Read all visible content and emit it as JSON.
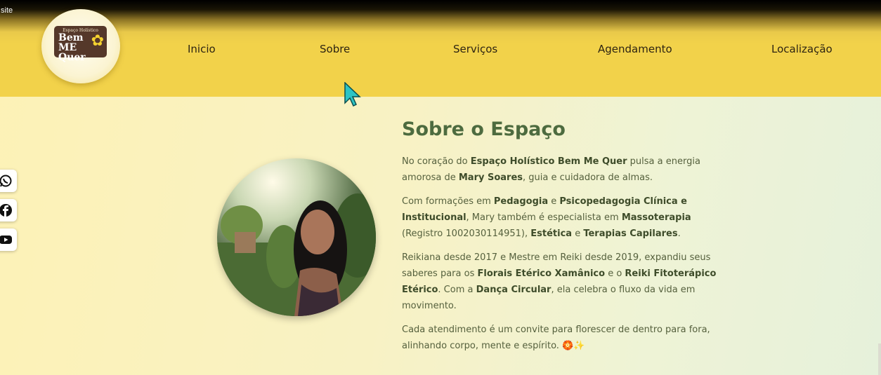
{
  "window": {
    "title_fragment": "site"
  },
  "logo": {
    "small_text": "Espaço Holístico",
    "line1": "Bem",
    "line2": "ME Quer"
  },
  "nav": {
    "items": [
      "Inicio",
      "Sobre",
      "Serviços",
      "Agendamento",
      "Localização"
    ]
  },
  "social": [
    "whatsapp-icon",
    "facebook-icon",
    "youtube-icon"
  ],
  "about": {
    "title": "Sobre o Espaço",
    "p1": {
      "t1": "No coração do ",
      "b1": "Espaço Holístico Bem Me Quer",
      "t2": " pulsa a energia amorosa de ",
      "b2": "Mary Soares",
      "t3": ", guia e cuidadora de almas."
    },
    "p2": {
      "t1": "Com formações em ",
      "b1": "Pedagogia",
      "t2": " e ",
      "b2": "Psicopedagogia Clínica e Institucional",
      "t3": ", Mary também é especialista em ",
      "b3": "Massoterapia",
      "t4": " (Registro 1002030114951), ",
      "b4": "Estética",
      "t5": " e ",
      "b5": "Terapias Capilares",
      "t6": "."
    },
    "p3": {
      "t1": "Reikiana desde 2017 e Mestre em Reiki desde 2019, expandiu seus saberes para os ",
      "b1": "Florais Etérico Xamânico",
      "t2": " e o ",
      "b2": "Reiki Fitoterápico Etérico",
      "t3": ". Com a ",
      "b3": "Dança Circular",
      "t4": ", ela celebra o fluxo da vida em movimento."
    },
    "p4": {
      "t1": "Cada atendimento é um convite para florescer de dentro para fora, alinhando corpo, mente e espírito. ",
      "emoji": "🏵️✨"
    }
  },
  "colors": {
    "nav_bg": "#f2d24a",
    "title": "#4d6b3f",
    "text": "#55603d"
  }
}
